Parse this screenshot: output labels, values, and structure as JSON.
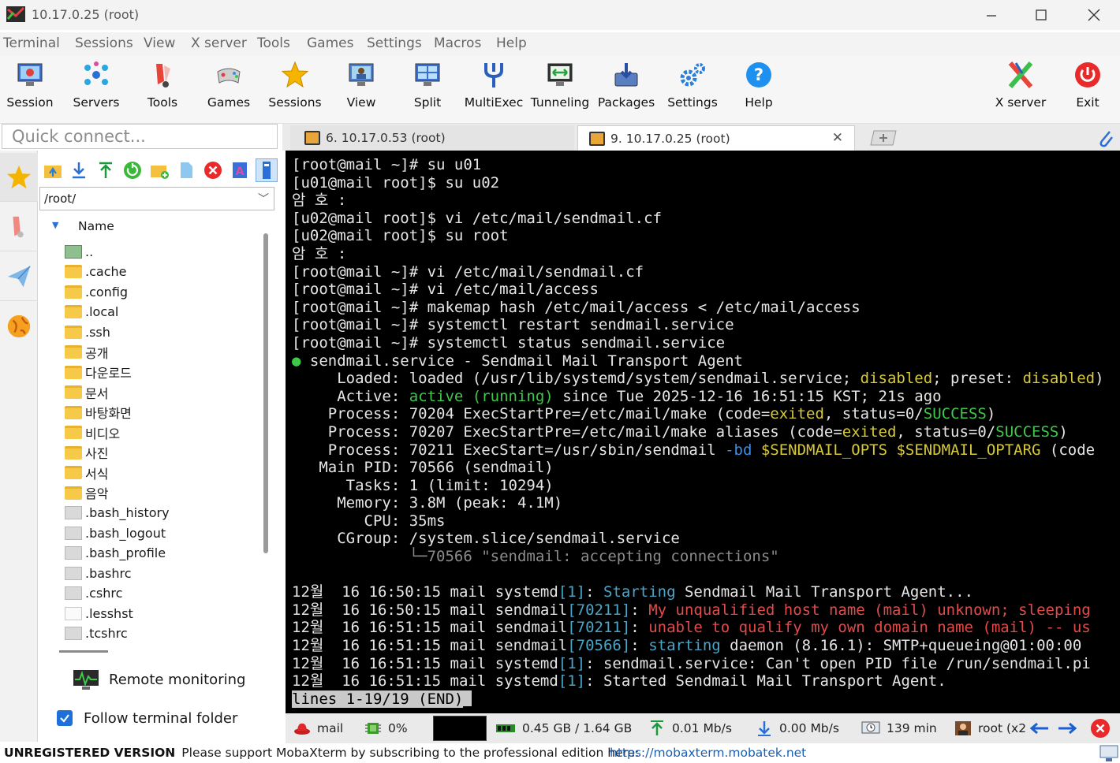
{
  "window": {
    "title": "10.17.0.25 (root)"
  },
  "menu": [
    "Terminal",
    "Sessions",
    "View",
    "X server",
    "Tools",
    "Games",
    "Settings",
    "Macros",
    "Help"
  ],
  "toolbar": {
    "items": [
      {
        "label": "Session",
        "icon": "session-icon"
      },
      {
        "label": "Servers",
        "icon": "servers-icon"
      },
      {
        "label": "Tools",
        "icon": "tools-icon"
      },
      {
        "label": "Games",
        "icon": "games-icon"
      },
      {
        "label": "Sessions",
        "icon": "star-icon"
      },
      {
        "label": "View",
        "icon": "view-icon"
      },
      {
        "label": "Split",
        "icon": "split-icon"
      },
      {
        "label": "MultiExec",
        "icon": "multiexec-icon"
      },
      {
        "label": "Tunneling",
        "icon": "tunneling-icon"
      },
      {
        "label": "Packages",
        "icon": "packages-icon"
      },
      {
        "label": "Settings",
        "icon": "gear-icon"
      },
      {
        "label": "Help",
        "icon": "help-icon"
      }
    ],
    "xserver_label": "X server",
    "exit_label": "Exit"
  },
  "quick_connect": {
    "placeholder": "Quick connect..."
  },
  "tabs": [
    {
      "label": "6. 10.17.0.53 (root)",
      "active": false
    },
    {
      "label": "9. 10.17.0.25 (root)",
      "active": true
    }
  ],
  "sftp": {
    "path": "/root/",
    "column_name": "Name",
    "files": [
      {
        "name": "..",
        "type": "up"
      },
      {
        "name": ".cache",
        "type": "folder"
      },
      {
        "name": ".config",
        "type": "folder"
      },
      {
        "name": ".local",
        "type": "folder"
      },
      {
        "name": ".ssh",
        "type": "folder"
      },
      {
        "name": "공개",
        "type": "folder"
      },
      {
        "name": "다운로드",
        "type": "folder"
      },
      {
        "name": "문서",
        "type": "folder"
      },
      {
        "name": "바탕화면",
        "type": "folder"
      },
      {
        "name": "비디오",
        "type": "folder"
      },
      {
        "name": "사진",
        "type": "folder"
      },
      {
        "name": "서식",
        "type": "folder"
      },
      {
        "name": "음악",
        "type": "folder"
      },
      {
        "name": ".bash_history",
        "type": "file"
      },
      {
        "name": ".bash_logout",
        "type": "file"
      },
      {
        "name": ".bash_profile",
        "type": "file"
      },
      {
        "name": ".bashrc",
        "type": "file"
      },
      {
        "name": ".cshrc",
        "type": "file"
      },
      {
        "name": ".lesshst",
        "type": "file-white"
      },
      {
        "name": ".tcshrc",
        "type": "file"
      }
    ],
    "remote_monitoring": "Remote monitoring",
    "follow_folder": "Follow terminal folder",
    "follow_checked": true
  },
  "terminal": {
    "lines": [
      [
        {
          "t": "[root@mail ~]# su u01"
        }
      ],
      [
        {
          "t": "[u01@mail root]$ su u02"
        }
      ],
      [
        {
          "t": "암 호 :"
        }
      ],
      [
        {
          "t": "[u02@mail root]$ vi /etc/mail/sendmail.cf"
        }
      ],
      [
        {
          "t": "[u02@mail root]$ su root"
        }
      ],
      [
        {
          "t": "암 호 :"
        }
      ],
      [
        {
          "t": "[root@mail ~]# vi /etc/mail/sendmail.cf"
        }
      ],
      [
        {
          "t": "[root@mail ~]# vi /etc/mail/access"
        }
      ],
      [
        {
          "t": "[root@mail ~]# makemap hash /etc/mail/access < /etc/mail/access"
        }
      ],
      [
        {
          "t": "[root@mail ~]# systemctl restart sendmail.service"
        }
      ],
      [
        {
          "t": "[root@mail ~]# systemctl status sendmail.service"
        }
      ],
      [
        {
          "t": "●",
          "c": "c-g"
        },
        {
          "t": " sendmail.service - Sendmail Mail Transport Agent"
        }
      ],
      [
        {
          "t": "     Loaded: loaded (/usr/lib/systemd/system/sendmail.service; "
        },
        {
          "t": "disabled",
          "c": "c-y"
        },
        {
          "t": "; preset: "
        },
        {
          "t": "disabled",
          "c": "c-y"
        },
        {
          "t": ")"
        }
      ],
      [
        {
          "t": "     Active: "
        },
        {
          "t": "active (running)",
          "c": "c-g"
        },
        {
          "t": " since Tue 2025-12-16 16:51:15 KST; 21s ago"
        }
      ],
      [
        {
          "t": "    Process: 70204 ExecStartPre=/etc/mail/make (code="
        },
        {
          "t": "exited",
          "c": "c-y"
        },
        {
          "t": ", status=0/"
        },
        {
          "t": "SUCCESS",
          "c": "c-g"
        },
        {
          "t": ")"
        }
      ],
      [
        {
          "t": "    Process: 70207 ExecStartPre=/etc/mail/make aliases (code="
        },
        {
          "t": "exited",
          "c": "c-y"
        },
        {
          "t": ", status=0/"
        },
        {
          "t": "SUCCESS",
          "c": "c-g"
        },
        {
          "t": ")"
        }
      ],
      [
        {
          "t": "    Process: 70211 ExecStart=/usr/sbin/sendmail "
        },
        {
          "t": "-bd",
          "c": "c-b"
        },
        {
          "t": " "
        },
        {
          "t": "$SENDMAIL_OPTS $SENDMAIL_OPTARG",
          "c": "c-y"
        },
        {
          "t": " (code"
        }
      ],
      [
        {
          "t": "   Main PID: 70566 (sendmail)"
        }
      ],
      [
        {
          "t": "      Tasks: 1 (limit: 10294)"
        }
      ],
      [
        {
          "t": "     Memory: 3.8M (peak: 4.1M)"
        }
      ],
      [
        {
          "t": "        CPU: 35ms"
        }
      ],
      [
        {
          "t": "     CGroup: /system.slice/sendmail.service"
        }
      ],
      [
        {
          "t": "             └─70566 \"sendmail: accepting connections\"",
          "c": "c-grey"
        }
      ],
      [
        {
          "t": ""
        }
      ],
      [
        {
          "t": "12월  16 16:50:15 mail systemd"
        },
        {
          "t": "[1]",
          "c": "c-cy"
        },
        {
          "t": ": "
        },
        {
          "t": "Starting",
          "c": "c-cy"
        },
        {
          "t": " Sendmail Mail Transport Agent..."
        }
      ],
      [
        {
          "t": "12월  16 16:50:15 mail sendmail"
        },
        {
          "t": "[70211]",
          "c": "c-cy"
        },
        {
          "t": ": "
        },
        {
          "t": "My unqualified host name (mail) unknown; sleeping",
          "c": "c-r"
        }
      ],
      [
        {
          "t": "12월  16 16:51:15 mail sendmail"
        },
        {
          "t": "[70211]",
          "c": "c-cy"
        },
        {
          "t": ": "
        },
        {
          "t": "unable to qualify my own domain name (mail) -- us",
          "c": "c-r"
        }
      ],
      [
        {
          "t": "12월  16 16:51:15 mail sendmail"
        },
        {
          "t": "[70566]",
          "c": "c-cy"
        },
        {
          "t": ": "
        },
        {
          "t": "starting",
          "c": "c-cy"
        },
        {
          "t": " daemon (8.16.1): SMTP+queueing@01:00:00"
        }
      ],
      [
        {
          "t": "12월  16 16:51:15 mail systemd"
        },
        {
          "t": "[1]",
          "c": "c-cy"
        },
        {
          "t": ": sendmail.service: Can't open PID file /run/sendmail.pi"
        }
      ],
      [
        {
          "t": "12월  16 16:51:15 mail systemd"
        },
        {
          "t": "[1]",
          "c": "c-cy"
        },
        {
          "t": ": Started Sendmail Mail Transport Agent."
        }
      ]
    ],
    "end_line": "lines 1-19/19 (END)"
  },
  "status": {
    "host": "mail",
    "cpu": "0%",
    "memory": "0.45 GB / 1.64 GB",
    "upload": "0.01 Mb/s",
    "download": "0.00 Mb/s",
    "uptime": "139 min",
    "user": "root (x2"
  },
  "bottom": {
    "unregistered": "UNREGISTERED VERSION",
    "message": "  -  Please support MobaXterm by subscribing to the professional edition here:  ",
    "link": "https://mobaxterm.mobatek.net"
  }
}
